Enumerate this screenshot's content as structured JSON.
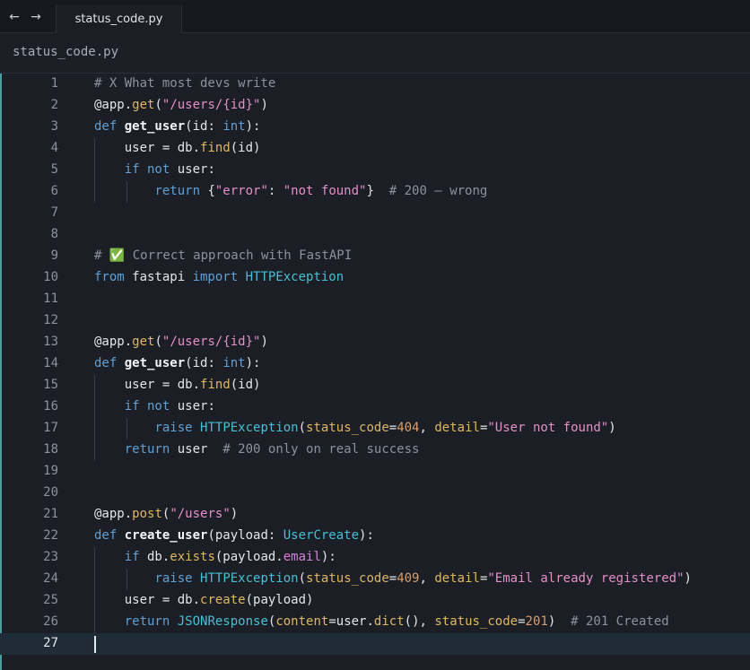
{
  "tabbar": {
    "back_icon": "←",
    "forward_icon": "→",
    "active_tab": "status_code.py"
  },
  "breadcrumb": "status_code.py",
  "editor": {
    "current_line": 27,
    "lines": [
      {
        "n": "1",
        "tokens": [
          {
            "t": "# X What most devs write",
            "c": "cm"
          }
        ]
      },
      {
        "n": "2",
        "tokens": [
          {
            "t": "@app.",
            "c": ""
          },
          {
            "t": "get",
            "c": "fn"
          },
          {
            "t": "(",
            "c": ""
          },
          {
            "t": "\"/users/{id}\"",
            "c": "str"
          },
          {
            "t": ")",
            "c": ""
          }
        ]
      },
      {
        "n": "3",
        "tokens": [
          {
            "t": "def ",
            "c": "kw"
          },
          {
            "t": "get_user",
            "c": "bold"
          },
          {
            "t": "(id: ",
            "c": ""
          },
          {
            "t": "int",
            "c": "type"
          },
          {
            "t": "):",
            "c": ""
          }
        ]
      },
      {
        "n": "4",
        "tokens": [
          {
            "t": "    user = db.",
            "c": ""
          },
          {
            "t": "find",
            "c": "fn"
          },
          {
            "t": "(id)",
            "c": ""
          }
        ]
      },
      {
        "n": "5",
        "tokens": [
          {
            "t": "    ",
            "c": ""
          },
          {
            "t": "if not",
            "c": "kw"
          },
          {
            "t": " user:",
            "c": ""
          }
        ]
      },
      {
        "n": "6",
        "tokens": [
          {
            "t": "        ",
            "c": ""
          },
          {
            "t": "return",
            "c": "kw"
          },
          {
            "t": " {",
            "c": ""
          },
          {
            "t": "\"error\"",
            "c": "str"
          },
          {
            "t": ": ",
            "c": ""
          },
          {
            "t": "\"not found\"",
            "c": "str"
          },
          {
            "t": "}  ",
            "c": ""
          },
          {
            "t": "# 200 — wrong",
            "c": "cm"
          }
        ]
      },
      {
        "n": "7",
        "tokens": []
      },
      {
        "n": "8",
        "tokens": []
      },
      {
        "n": "9",
        "tokens": [
          {
            "t": "# ✅ Correct approach with FastAPI",
            "c": "cm"
          }
        ]
      },
      {
        "n": "10",
        "tokens": [
          {
            "t": "from",
            "c": "kw"
          },
          {
            "t": " fastapi ",
            "c": ""
          },
          {
            "t": "import",
            "c": "kw"
          },
          {
            "t": " ",
            "c": ""
          },
          {
            "t": "HTTPException",
            "c": "cls"
          }
        ]
      },
      {
        "n": "11",
        "tokens": []
      },
      {
        "n": "12",
        "tokens": []
      },
      {
        "n": "13",
        "tokens": [
          {
            "t": "@app.",
            "c": ""
          },
          {
            "t": "get",
            "c": "fn"
          },
          {
            "t": "(",
            "c": ""
          },
          {
            "t": "\"/users/{id}\"",
            "c": "str"
          },
          {
            "t": ")",
            "c": ""
          }
        ]
      },
      {
        "n": "14",
        "tokens": [
          {
            "t": "def ",
            "c": "kw"
          },
          {
            "t": "get_user",
            "c": "bold"
          },
          {
            "t": "(id: ",
            "c": ""
          },
          {
            "t": "int",
            "c": "type"
          },
          {
            "t": "):",
            "c": ""
          }
        ]
      },
      {
        "n": "15",
        "tokens": [
          {
            "t": "    user = db.",
            "c": ""
          },
          {
            "t": "find",
            "c": "fn"
          },
          {
            "t": "(id)",
            "c": ""
          }
        ]
      },
      {
        "n": "16",
        "tokens": [
          {
            "t": "    ",
            "c": ""
          },
          {
            "t": "if not",
            "c": "kw"
          },
          {
            "t": " user:",
            "c": ""
          }
        ]
      },
      {
        "n": "17",
        "tokens": [
          {
            "t": "        ",
            "c": ""
          },
          {
            "t": "raise",
            "c": "kw"
          },
          {
            "t": " ",
            "c": ""
          },
          {
            "t": "HTTPException",
            "c": "cls"
          },
          {
            "t": "(",
            "c": ""
          },
          {
            "t": "status_code",
            "c": "param"
          },
          {
            "t": "=",
            "c": ""
          },
          {
            "t": "404",
            "c": "num"
          },
          {
            "t": ", ",
            "c": ""
          },
          {
            "t": "detail",
            "c": "param"
          },
          {
            "t": "=",
            "c": ""
          },
          {
            "t": "\"User not found\"",
            "c": "str"
          },
          {
            "t": ")",
            "c": ""
          }
        ]
      },
      {
        "n": "18",
        "tokens": [
          {
            "t": "    ",
            "c": ""
          },
          {
            "t": "return",
            "c": "kw"
          },
          {
            "t": " user  ",
            "c": ""
          },
          {
            "t": "# 200 only on real success",
            "c": "cm"
          }
        ]
      },
      {
        "n": "19",
        "tokens": []
      },
      {
        "n": "20",
        "tokens": []
      },
      {
        "n": "21",
        "tokens": [
          {
            "t": "@app.",
            "c": ""
          },
          {
            "t": "post",
            "c": "fn"
          },
          {
            "t": "(",
            "c": ""
          },
          {
            "t": "\"/users\"",
            "c": "str"
          },
          {
            "t": ")",
            "c": ""
          }
        ]
      },
      {
        "n": "22",
        "tokens": [
          {
            "t": "def ",
            "c": "kw"
          },
          {
            "t": "create_user",
            "c": "bold"
          },
          {
            "t": "(payload: ",
            "c": ""
          },
          {
            "t": "UserCreate",
            "c": "cls"
          },
          {
            "t": "):",
            "c": ""
          }
        ]
      },
      {
        "n": "23",
        "tokens": [
          {
            "t": "    ",
            "c": ""
          },
          {
            "t": "if",
            "c": "kw"
          },
          {
            "t": " db.",
            "c": ""
          },
          {
            "t": "exists",
            "c": "fn"
          },
          {
            "t": "(payload.",
            "c": ""
          },
          {
            "t": "email",
            "c": "attr"
          },
          {
            "t": "):",
            "c": ""
          }
        ]
      },
      {
        "n": "24",
        "tokens": [
          {
            "t": "        ",
            "c": ""
          },
          {
            "t": "raise",
            "c": "kw"
          },
          {
            "t": " ",
            "c": ""
          },
          {
            "t": "HTTPException",
            "c": "cls"
          },
          {
            "t": "(",
            "c": ""
          },
          {
            "t": "status_code",
            "c": "param"
          },
          {
            "t": "=",
            "c": ""
          },
          {
            "t": "409",
            "c": "num"
          },
          {
            "t": ", ",
            "c": ""
          },
          {
            "t": "detail",
            "c": "param"
          },
          {
            "t": "=",
            "c": ""
          },
          {
            "t": "\"Email already registered\"",
            "c": "str"
          },
          {
            "t": ")",
            "c": ""
          }
        ]
      },
      {
        "n": "25",
        "tokens": [
          {
            "t": "    user = db.",
            "c": ""
          },
          {
            "t": "create",
            "c": "fn"
          },
          {
            "t": "(payload)",
            "c": ""
          }
        ]
      },
      {
        "n": "26",
        "tokens": [
          {
            "t": "    ",
            "c": ""
          },
          {
            "t": "return",
            "c": "kw"
          },
          {
            "t": " ",
            "c": ""
          },
          {
            "t": "JSONResponse",
            "c": "cls"
          },
          {
            "t": "(",
            "c": ""
          },
          {
            "t": "content",
            "c": "param"
          },
          {
            "t": "=user.",
            "c": ""
          },
          {
            "t": "dict",
            "c": "fn"
          },
          {
            "t": "(), ",
            "c": ""
          },
          {
            "t": "status_code",
            "c": "param"
          },
          {
            "t": "=",
            "c": ""
          },
          {
            "t": "201",
            "c": "num"
          },
          {
            "t": ")  ",
            "c": ""
          },
          {
            "t": "# 201 Created",
            "c": "cm"
          }
        ]
      },
      {
        "n": "27",
        "tokens": []
      }
    ]
  },
  "colors": {
    "background": "#1b1f25",
    "keyword": "#5ea1d8",
    "function": "#e0b762",
    "string": "#e58fc8",
    "number": "#d89e6c",
    "class": "#47bfd6",
    "comment": "#8b939d",
    "current_line": "#1f2c38"
  }
}
